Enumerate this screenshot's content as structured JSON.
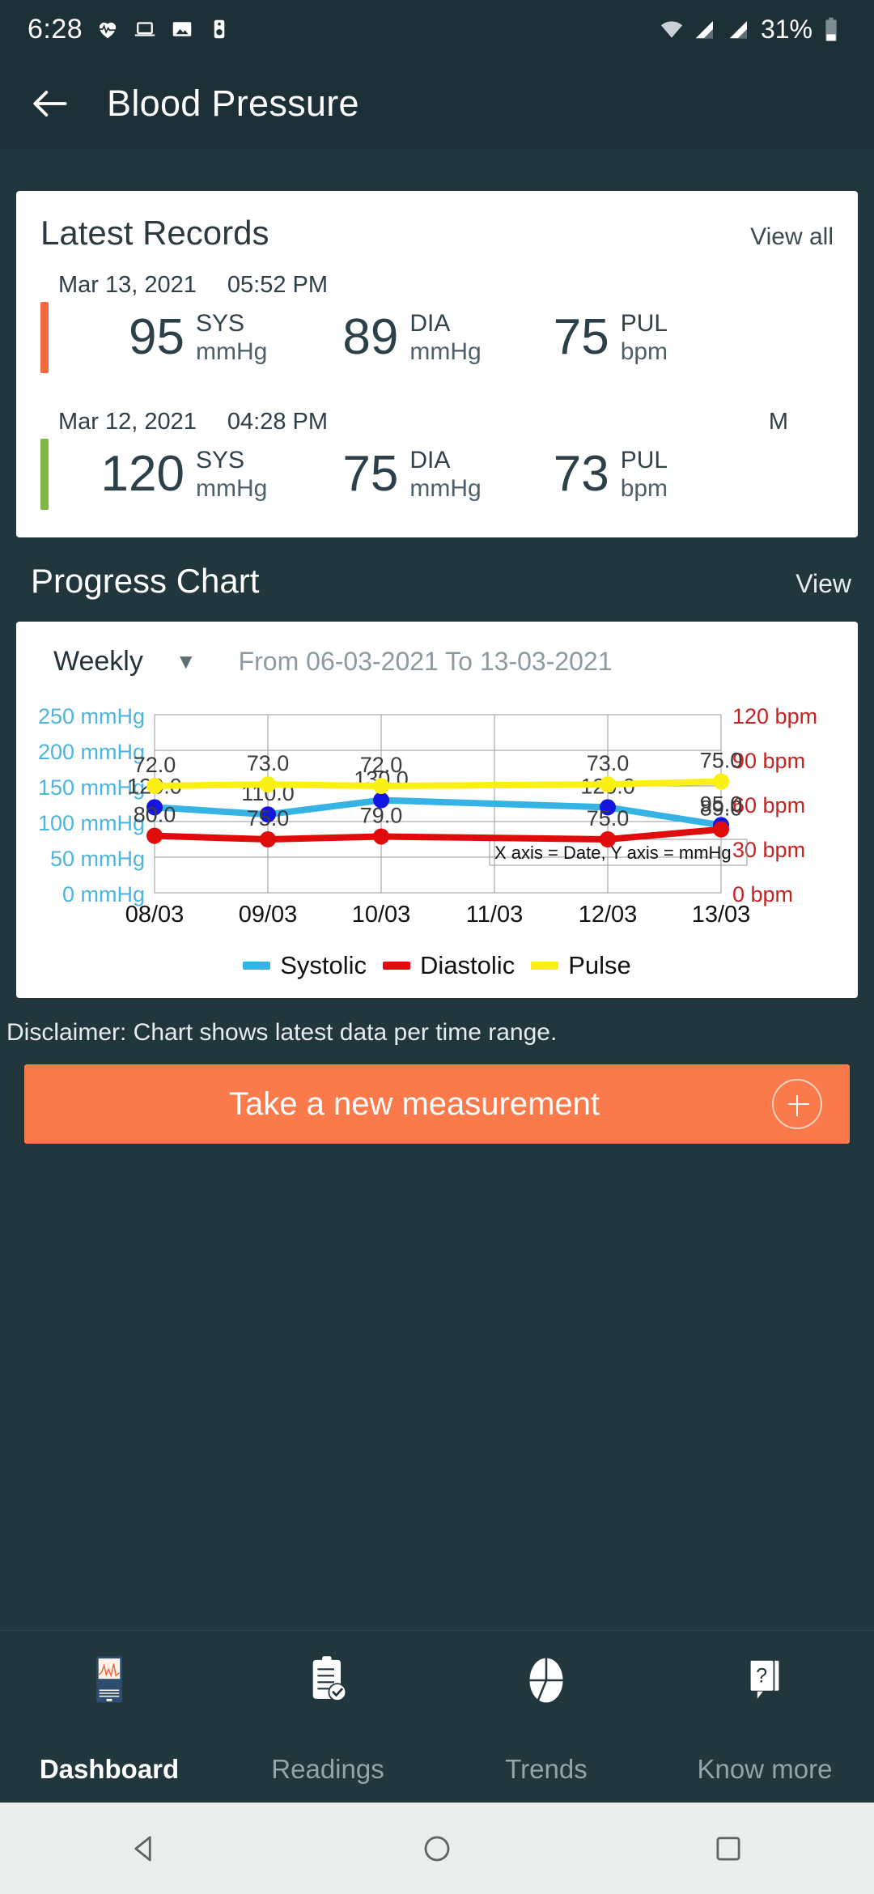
{
  "status_bar": {
    "time": "6:28",
    "battery_percent": "31%",
    "icons": [
      "heart-pulse-icon",
      "laptop-icon",
      "photo-icon",
      "speaker-icon",
      "wifi-icon",
      "signal-icon",
      "signal-2-icon",
      "battery-icon"
    ]
  },
  "app_bar": {
    "title": "Blood Pressure",
    "back_icon": "back-arrow-icon"
  },
  "records_card": {
    "title": "Latest Records",
    "view_all_label": "View all",
    "unit_mmhg": "mmHg",
    "unit_bpm": "bpm",
    "label_sys": "SYS",
    "label_dia": "DIA",
    "label_pul": "PUL",
    "records": [
      {
        "date": "Mar 13, 2021",
        "time": "05:52 PM",
        "flag": "",
        "bar_color": "#f2693c",
        "sys": "95",
        "dia": "89",
        "pul": "75"
      },
      {
        "date": "Mar 12, 2021",
        "time": "04:28 PM",
        "flag": "M",
        "bar_color": "#7fb844",
        "sys": "120",
        "dia": "75",
        "pul": "73"
      }
    ]
  },
  "progress_section": {
    "title": "Progress Chart",
    "view_label": "View",
    "range_value": "Weekly",
    "range_caret": "▼",
    "range_dates": "From 06-03-2021  To 13-03-2021"
  },
  "disclaimer": "Disclaimer: Chart shows latest data per time range.",
  "cta": {
    "label": "Take a new measurement",
    "icon": "plus-circle-icon",
    "color": "#fa7a4b"
  },
  "bottom_nav": {
    "items": [
      {
        "label": "Dashboard",
        "icon": "monitor-chart-icon",
        "active": true
      },
      {
        "label": "Readings",
        "icon": "clipboard-check-icon",
        "active": false
      },
      {
        "label": "Trends",
        "icon": "pie-chart-icon",
        "active": false
      },
      {
        "label": "Know more",
        "icon": "question-book-icon",
        "active": false
      }
    ]
  },
  "system_nav": {
    "back": "triangle-back-icon",
    "home": "circle-home-icon",
    "recents": "square-recents-icon"
  },
  "chart_data": {
    "type": "line",
    "title": "Progress Chart",
    "x": [
      "08/03",
      "09/03",
      "10/03",
      "11/03",
      "12/03",
      "13/03"
    ],
    "xlabel": "Date",
    "ylabel": "mmHg",
    "annotation": "X axis = Date, Y axis = mmHg",
    "y_left_ticks": [
      "0 mmHg",
      "50 mmHg",
      "100 mmHg",
      "150 mmHg",
      "200 mmHg",
      "250 mmHg"
    ],
    "y_left_values": [
      0,
      50,
      100,
      150,
      200,
      250
    ],
    "y_left_color": "#4bb4e0",
    "y_right_ticks": [
      "0 bpm",
      "30 bpm",
      "60 bpm",
      "90 bpm",
      "120 bpm"
    ],
    "y_right_values": [
      0,
      30,
      60,
      90,
      120
    ],
    "y_right_color": "#c62222",
    "ylim": [
      0,
      250
    ],
    "ylim_right": [
      0,
      120
    ],
    "grid": true,
    "legend_position": "bottom",
    "series": [
      {
        "name": "Systolic",
        "color": "#35b3e5",
        "marker_color": "#1515e0",
        "axis": "left",
        "values": [
          120.0,
          110.0,
          130.0,
          null,
          120.0,
          95.0
        ],
        "labels": [
          "120.0",
          "110.0",
          "130.0",
          "",
          "120.0",
          "95.0"
        ]
      },
      {
        "name": "Diastolic",
        "color": "#e00b0b",
        "marker_color": "#e00b0b",
        "axis": "left",
        "values": [
          80.0,
          75.0,
          79.0,
          null,
          75.0,
          89.0
        ],
        "labels": [
          "80.0",
          "75.0",
          "79.0",
          "",
          "75.0",
          "89.0"
        ]
      },
      {
        "name": "Pulse",
        "color": "#faf014",
        "marker_color": "#faf014",
        "axis": "right",
        "values": [
          72.0,
          73.0,
          72.0,
          null,
          73.0,
          75.0
        ],
        "labels": [
          "72.0",
          "73.0",
          "72.0",
          "",
          "73.0",
          "75.0"
        ]
      }
    ]
  }
}
